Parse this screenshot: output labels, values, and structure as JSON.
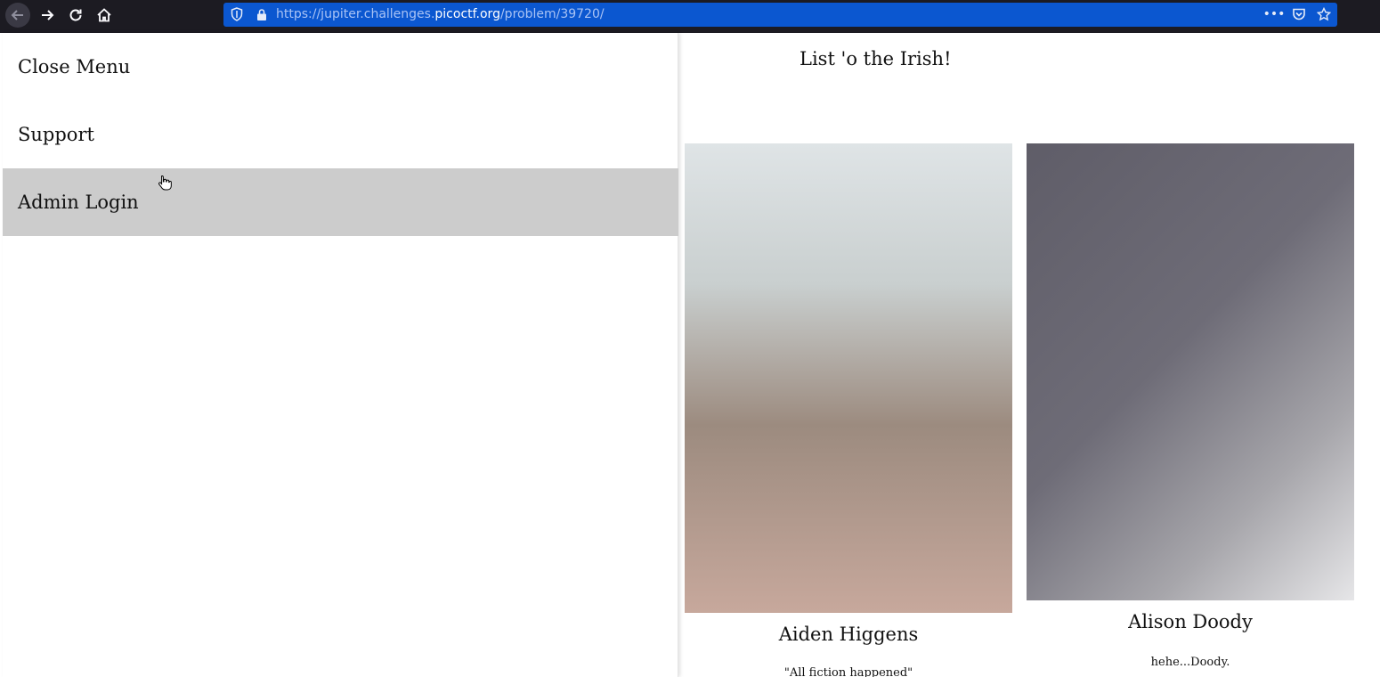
{
  "browser": {
    "url_prefix": "https://jupiter.challenges.",
    "url_domain": "picoctf.org",
    "url_path": "/problem/39720/",
    "icons": [
      "back-arrow-icon",
      "forward-arrow-icon",
      "reload-icon",
      "home-icon",
      "shield-icon",
      "lock-icon",
      "more-icon",
      "pocket-icon",
      "star-icon"
    ]
  },
  "menu": {
    "items": [
      {
        "label": "Close Menu"
      },
      {
        "label": "Support"
      },
      {
        "label": "Admin Login"
      }
    ]
  },
  "main": {
    "title": "List 'o the Irish!",
    "people": [
      {
        "name": "Aiden Higgens",
        "quote": "\"All fiction happened\""
      },
      {
        "name": "Alison Doody",
        "quote": "hehe...Doody."
      }
    ]
  },
  "colors": {
    "toolbar_bg": "#1c1b22",
    "urlbar_bg": "#0b57d0",
    "menu_hover_bg": "#cccccc"
  }
}
